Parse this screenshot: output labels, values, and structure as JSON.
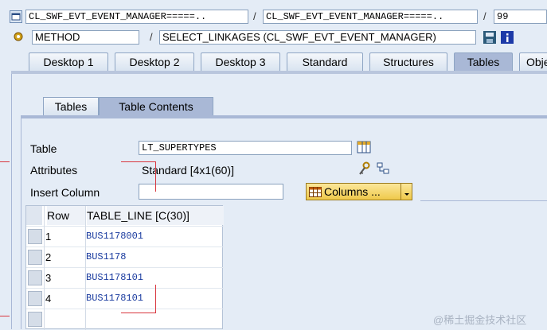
{
  "row1": {
    "class_field": "CL_SWF_EVT_EVENT_MANAGER=====..",
    "include_field": "CL_SWF_EVT_EVENT_MANAGER=====..",
    "line_field": "99"
  },
  "row2": {
    "type_field": "METHOD",
    "method_field": "SELECT_LINKAGES (CL_SWF_EVT_EVENT_MANAGER)"
  },
  "tabs": [
    {
      "label": "Desktop 1"
    },
    {
      "label": "Desktop 2"
    },
    {
      "label": "Desktop 3"
    },
    {
      "label": "Standard"
    },
    {
      "label": "Structures"
    },
    {
      "label": "Tables"
    },
    {
      "label": "Obje"
    }
  ],
  "subtabs": [
    {
      "label": "Tables"
    },
    {
      "label": "Table Contents"
    }
  ],
  "form": {
    "table_label": "Table",
    "table_value": "LT_SUPERTYPES",
    "attributes_label": "Attributes",
    "attributes_value": "Standard [4x1(60)]",
    "insert_label": "Insert Column",
    "insert_value": "",
    "columns_button": "Columns ..."
  },
  "grid": {
    "headers": [
      "Row",
      "TABLE_LINE [C(30)]"
    ],
    "rows": [
      {
        "row": "1",
        "value": "BUS1178001"
      },
      {
        "row": "2",
        "value": "BUS1178"
      },
      {
        "row": "3",
        "value": "BUS1178101"
      },
      {
        "row": "4",
        "value": "BUS1178101"
      }
    ]
  },
  "watermark": "@稀土掘金技术社区"
}
